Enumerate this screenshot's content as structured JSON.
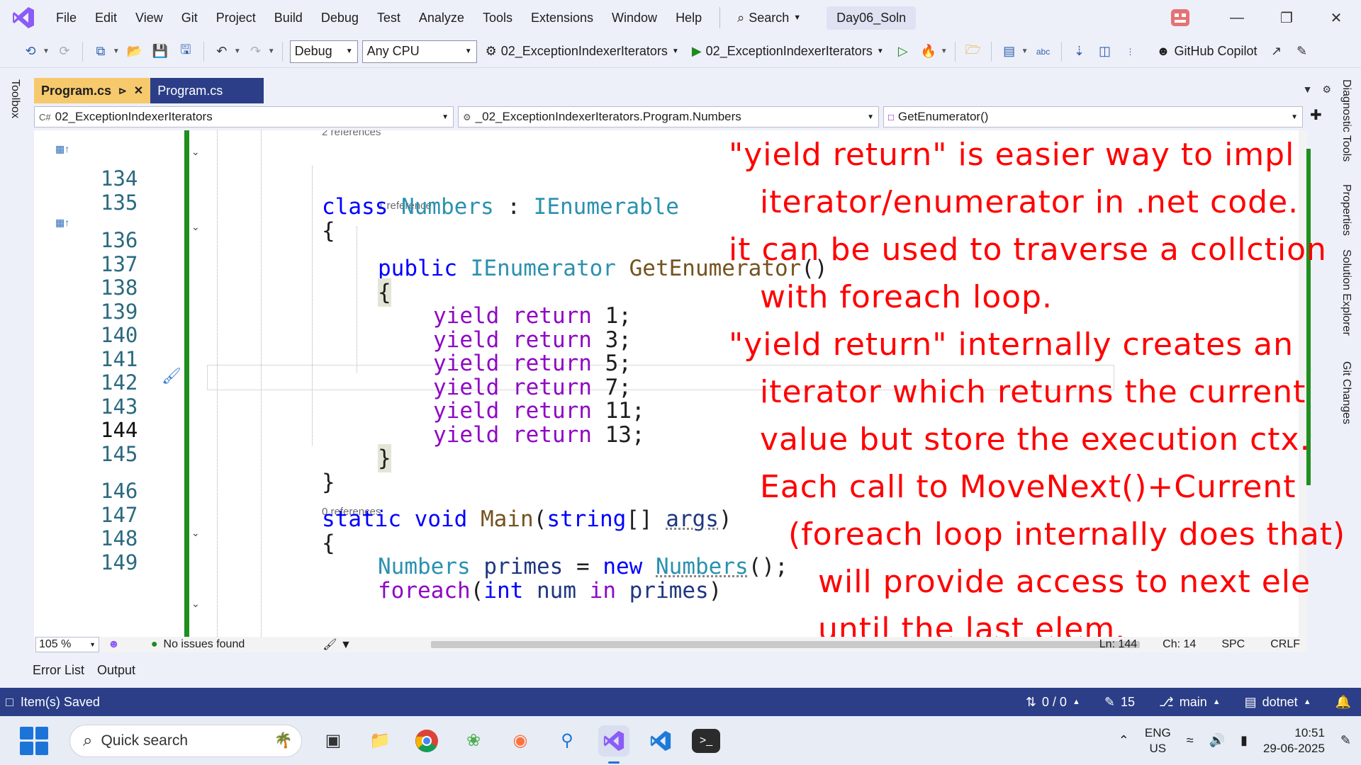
{
  "menu": {
    "items": [
      "File",
      "Edit",
      "View",
      "Git",
      "Project",
      "Build",
      "Debug",
      "Test",
      "Analyze",
      "Tools",
      "Extensions",
      "Window",
      "Help"
    ],
    "search_label": "Search",
    "solution_name": "Day06_Soln"
  },
  "toolbar": {
    "config": "Debug",
    "platform": "Any CPU",
    "startup_project": "02_ExceptionIndexerIterators",
    "run_target": "02_ExceptionIndexerIterators",
    "copilot": "GitHub Copilot"
  },
  "side_panels": {
    "left": "Toolbox",
    "right": [
      "Diagnostic Tools",
      "Properties",
      "Solution Explorer",
      "Git Changes"
    ]
  },
  "tabs": [
    {
      "label": "Program.cs",
      "active": true
    },
    {
      "label": "Program.cs",
      "active": false
    }
  ],
  "nav": {
    "project": "02_ExceptionIndexerIterators",
    "type": "_02_ExceptionIndexerIterators.Program.Numbers",
    "member": "GetEnumerator()"
  },
  "codelens": {
    "class": "2 references",
    "method": "1 reference",
    "main": "0 references"
  },
  "code_lines": [
    {
      "num": "134",
      "text": "class Numbers : IEnumerable"
    },
    {
      "num": "135",
      "text": "{"
    },
    {
      "num": "136",
      "text": "public IEnumerator GetEnumerator()"
    },
    {
      "num": "137",
      "text": "{"
    },
    {
      "num": "138",
      "text": "yield return 1;"
    },
    {
      "num": "139",
      "text": "yield return 3;"
    },
    {
      "num": "140",
      "text": "yield return 5;"
    },
    {
      "num": "141",
      "text": "yield return 7;"
    },
    {
      "num": "142",
      "text": "yield return 11;"
    },
    {
      "num": "143",
      "text": "yield return 13;"
    },
    {
      "num": "144",
      "text": "}"
    },
    {
      "num": "145",
      "text": "}"
    },
    {
      "num": "146",
      "text": "static void Main(string[] args)"
    },
    {
      "num": "147",
      "text": "{"
    },
    {
      "num": "148",
      "text": "Numbers primes = new Numbers();"
    },
    {
      "num": "149",
      "text": "foreach(int num in primes)"
    }
  ],
  "annotation": [
    "\"yield return\" is easier way to impl",
    "iterator/enumerator in .net code.",
    "it can be used to traverse a collction",
    "with foreach loop.",
    "\"yield return\" internally creates an",
    "iterator which returns the current",
    "value but store the execution ctx.",
    "Each call to MoveNext()+Current",
    "(foreach loop internally does that)",
    "will provide access to next ele",
    "until the last elem."
  ],
  "editor_status": {
    "zoom": "105 %",
    "issues": "No issues found",
    "line": "Ln: 144",
    "col": "Ch: 14",
    "whitespace": "SPC",
    "eol": "CRLF"
  },
  "bottom_tabs": [
    "Error List",
    "Output"
  ],
  "statusbar": {
    "message": "Item(s) Saved",
    "sync": "0 / 0",
    "edits": "15",
    "branch": "main",
    "repo": "dotnet"
  },
  "taskbar": {
    "search_placeholder": "Quick search",
    "lang_top": "ENG",
    "lang_bottom": "US",
    "time": "10:51",
    "date": "29-06-2025"
  }
}
